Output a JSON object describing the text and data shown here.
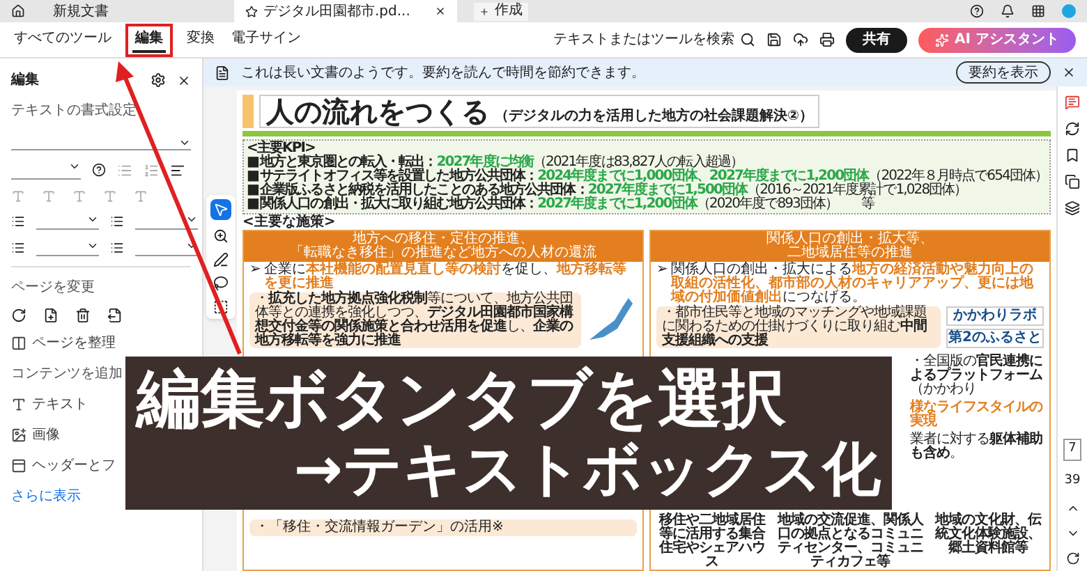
{
  "browser_tabs": [
    {
      "label": "新規文書",
      "selected": false
    },
    {
      "label": "デジタル田園都市.pd...",
      "selected": true
    }
  ],
  "new_button": "作成",
  "menu_tabs": [
    {
      "label": "すべてのツール",
      "selected": false
    },
    {
      "label": "編集",
      "selected": true
    },
    {
      "label": "変換",
      "selected": false
    },
    {
      "label": "電子サイン",
      "selected": false
    }
  ],
  "search_label": "テキストまたはツールを検索",
  "share_button": "共有",
  "ai_button": "AI アシスタント",
  "panel": {
    "title": "編集",
    "format_heading": "テキストの書式設定",
    "page_heading": "ページを変更",
    "organize": "ページを整理",
    "content_heading": "コンテンツを追加",
    "content_items": [
      {
        "kind": "text",
        "label": "テキスト"
      },
      {
        "kind": "image",
        "label": "画像"
      },
      {
        "kind": "header",
        "label": "ヘッダーとフ"
      }
    ],
    "more_link": "さらに表示"
  },
  "notice": {
    "text": "これは長い文書のようです。要約を読んで時間を節約できます。",
    "button": "要約を表示"
  },
  "page": {
    "title": "人の流れをつくる",
    "subtitle": "（デジタルの力を活用した地方の社会課題解決②）",
    "kpi_heading": "<主要KPI>",
    "kpis": [
      {
        "label": "地方と東京圏との転入・転出：",
        "target": "2027年度に均衡",
        "note": "（2021年度は83,827人の転入超過）"
      },
      {
        "label": "サテライトオフィス等を設置した地方公共団体：",
        "target": "2024年度までに1,000団体、2027年度までに1,200団体",
        "note": "（2022年８月時点で654団体）"
      },
      {
        "label": "企業版ふるさと納税を活用したことのある地方公共団体：",
        "target": "2027年度までに1,500団体",
        "note": "（2016～2021年度累計で1,028団体）"
      },
      {
        "label": "関係人口の創出・拡大に取り組む地方公共団体：",
        "target": "2027年度までに1,200団体",
        "note": "（2020年度で893団体）"
      }
    ],
    "kpi_suffix": "等",
    "kpi_marker": "■",
    "lead_marker": "➢",
    "measures_heading": "<主要な施策>",
    "left_column": {
      "header": [
        "地方への移住・定住の推進、",
        "「転職なき移住」の推進など地方への人材の還流"
      ],
      "lead": [
        {
          "text": "企業に",
          "accent": false
        },
        {
          "text": "本社機能の配置見直し等の検討",
          "accent": true
        },
        {
          "text": "を促し、",
          "accent": false
        },
        {
          "text": "地方移転等を更に推進",
          "accent": true
        }
      ],
      "note": "・**拡充した地方拠点強化税制**等について、地方公共団体等との連携を強化しつつ、**デジタル田園都市国家構想交付金等の関係施策と合わせ活用を促進**し、**企業の地方移転等を強力に推進**",
      "bottom": "・「移住・交流情報ガーデン」の活用※"
    },
    "right_column": {
      "header": [
        "関係人口の創出・拡大等、",
        "二地域居住等の推進"
      ],
      "lead": [
        {
          "text": "関係人口の創出・拡大による",
          "accent": false
        },
        {
          "text": "地方の経済活動や魅力向上の取組の活性化、都市部の人材のキャリアアップ、更には地域の付加価値創出",
          "accent": true
        },
        {
          "text": "につなげる。",
          "accent": false
        }
      ],
      "note": "・都市住民等と地域のマッチングや地域課題に関わるための仕掛けづくりに取り組む**中間支援組織への支援**",
      "logos": [
        "かかわりラボ",
        "第2のふるさと"
      ],
      "side_notes": [
        {
          "kind": "plain",
          "text": "・全国版の**官民連携によるプラットフォーム**（かかわり"
        },
        {
          "kind": "accent",
          "text": "様なライフスタイルの実現"
        },
        {
          "kind": "plain",
          "text": "業者に対する**躯体補助も含め**。"
        }
      ],
      "captions": [
        "移住や二地域居住等に活用する集合住宅やシェアハウス",
        "地域の交流促進、関係人口の拠点となるコミュニティセンター、コミュニティカフェ等",
        "地域の文化財、伝統文化体験施設、郷土資料館等"
      ]
    }
  },
  "page_nav": {
    "current": "7",
    "total": "39"
  },
  "caption_overlay": {
    "line_1": "編集ボタンタブを選択",
    "line_2": "→テキストボックス化"
  }
}
